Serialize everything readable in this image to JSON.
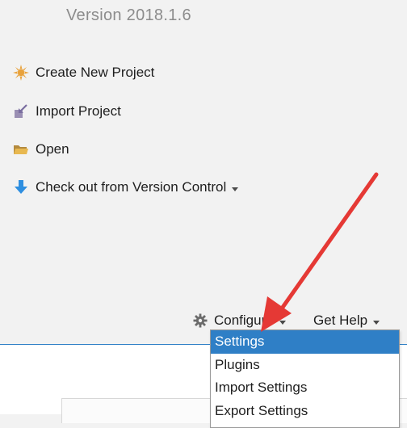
{
  "welcome": {
    "version": "Version 2018.1.6",
    "actions": [
      {
        "label": "Create New Project",
        "icon": "sun-star-icon"
      },
      {
        "label": "Import Project",
        "icon": "import-icon"
      },
      {
        "label": "Open",
        "icon": "folder-icon"
      },
      {
        "label": "Check out from Version Control",
        "icon": "download-arrow-icon"
      }
    ]
  },
  "bottom_bar": {
    "configure_label": "Configure",
    "get_help_label": "Get Help"
  },
  "configure_menu": {
    "items": [
      "Settings",
      "Plugins",
      "Import Settings",
      "Export Settings"
    ],
    "selected": "Settings"
  },
  "colors": {
    "accent": "#2f7fc6",
    "annotation_arrow": "#e53935",
    "background": "#f2f2f2"
  }
}
